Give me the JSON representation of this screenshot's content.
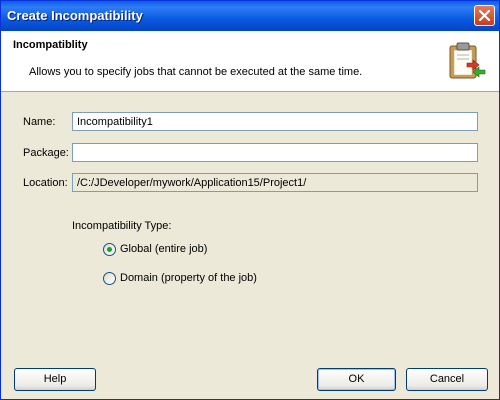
{
  "window": {
    "title": "Create Incompatibility"
  },
  "header": {
    "title": "Incompatiblity",
    "description": "Allows you to specify jobs that cannot be executed at the same time."
  },
  "form": {
    "name_label": "Name:",
    "name_value": "Incompatibility1",
    "package_label": "Package:",
    "package_value": "",
    "location_label": "Location:",
    "location_value": "/C:/JDeveloper/mywork/Application15/Project1/"
  },
  "incompatibility_type": {
    "label": "Incompatibility Type:",
    "options": [
      {
        "label": "Global (entire job)",
        "selected": true
      },
      {
        "label": "Domain (property of the job)",
        "selected": false
      }
    ]
  },
  "buttons": {
    "help": "Help",
    "ok": "OK",
    "cancel": "Cancel"
  },
  "colors": {
    "titlebar": "#0a5ce8",
    "dialog_bg": "#ece9d8",
    "input_border": "#7f9db9",
    "radio_dot": "#21a121"
  }
}
